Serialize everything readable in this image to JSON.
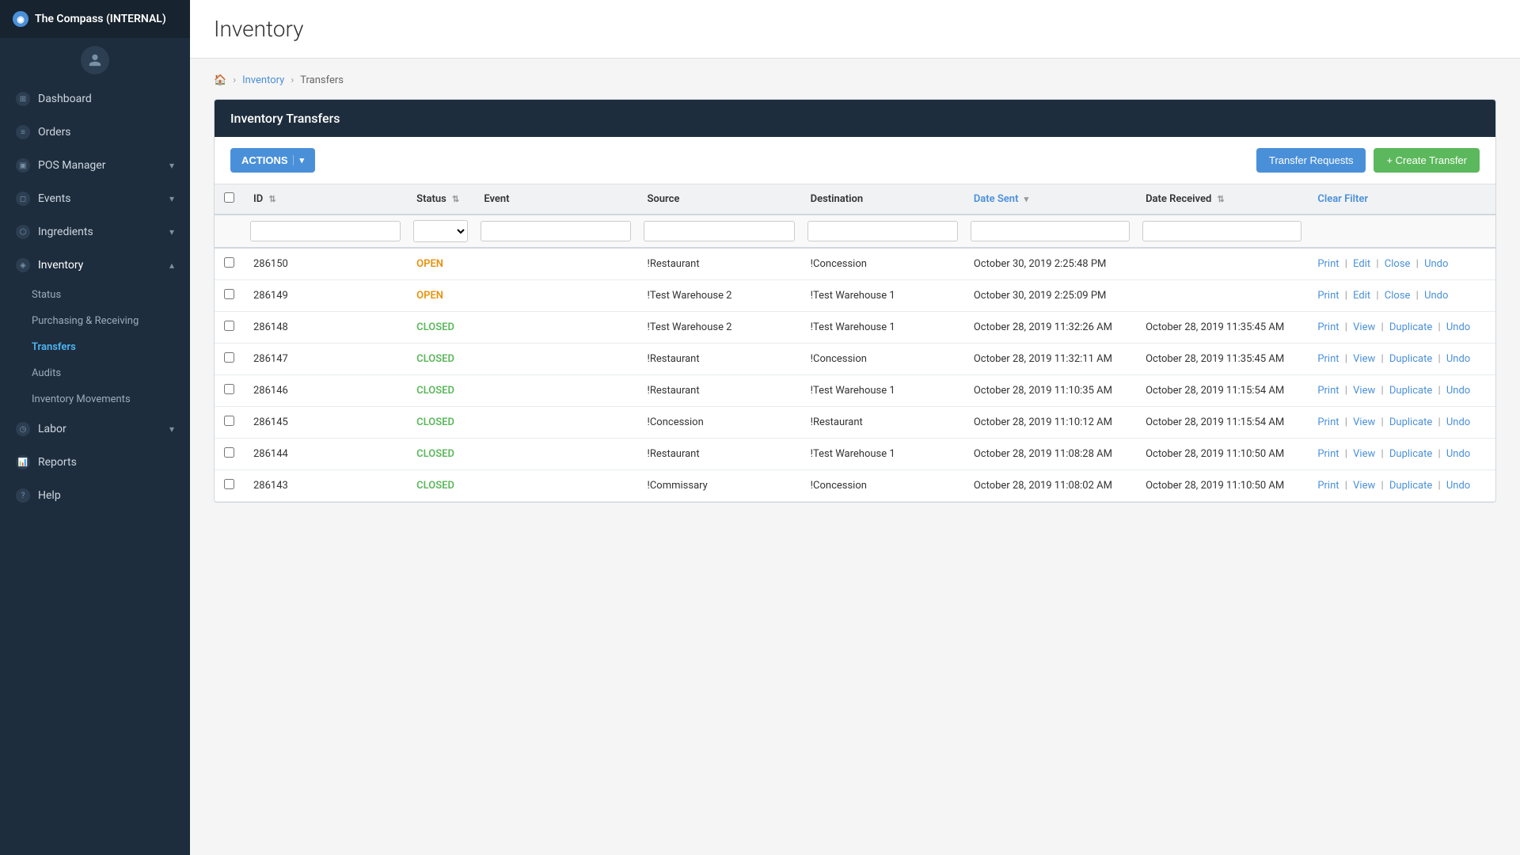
{
  "app": {
    "title": "The Compass (INTERNAL)"
  },
  "sidebar": {
    "user_icon": "👤",
    "items": [
      {
        "id": "dashboard",
        "label": "Dashboard",
        "icon": "⊞",
        "has_children": false
      },
      {
        "id": "orders",
        "label": "Orders",
        "icon": "📋",
        "has_children": false
      },
      {
        "id": "pos-manager",
        "label": "POS Manager",
        "icon": "🖥",
        "has_children": true
      },
      {
        "id": "events",
        "label": "Events",
        "icon": "📅",
        "has_children": true
      },
      {
        "id": "ingredients",
        "label": "Ingredients",
        "icon": "🧪",
        "has_children": true
      },
      {
        "id": "inventory",
        "label": "Inventory",
        "icon": "📦",
        "has_children": true,
        "active": true
      },
      {
        "id": "labor",
        "label": "Labor",
        "icon": "👷",
        "has_children": true
      },
      {
        "id": "reports",
        "label": "Reports",
        "icon": "📊",
        "has_children": false
      },
      {
        "id": "help",
        "label": "Help",
        "icon": "❓",
        "has_children": false
      }
    ],
    "inventory_sub": [
      {
        "id": "status",
        "label": "Status"
      },
      {
        "id": "purchasing-receiving",
        "label": "Purchasing & Receiving"
      },
      {
        "id": "transfers",
        "label": "Transfers",
        "active": true
      },
      {
        "id": "audits",
        "label": "Audits"
      },
      {
        "id": "inventory-movements",
        "label": "Inventory Movements"
      }
    ]
  },
  "page": {
    "title": "Inventory"
  },
  "breadcrumb": {
    "home_icon": "🏠",
    "items": [
      "Inventory",
      "Transfers"
    ]
  },
  "table": {
    "title": "Inventory Transfers",
    "actions_label": "ACTIONS",
    "transfer_requests_label": "Transfer Requests",
    "create_transfer_label": "+ Create Transfer",
    "clear_filter_label": "Clear Filter",
    "columns": [
      "ID",
      "Status",
      "Event",
      "Source",
      "Destination",
      "Date Sent",
      "Date Received",
      ""
    ],
    "rows": [
      {
        "id": "286150",
        "status": "OPEN",
        "status_class": "open",
        "event": "",
        "source": "!Restaurant",
        "destination": "!Concession",
        "date_sent": "October 30, 2019 2:25:48 PM",
        "date_received": "",
        "actions": [
          {
            "label": "Print"
          },
          {
            "label": "Edit"
          },
          {
            "label": "Close"
          },
          {
            "label": "Undo"
          }
        ],
        "action_str": "Print | Edit | Close | Undo"
      },
      {
        "id": "286149",
        "status": "OPEN",
        "status_class": "open",
        "event": "",
        "source": "!Test Warehouse 2",
        "destination": "!Test Warehouse 1",
        "date_sent": "October 30, 2019 2:25:09 PM",
        "date_received": "",
        "actions": [],
        "action_str": "Print | Edit | Close | Undo"
      },
      {
        "id": "286148",
        "status": "CLOSED",
        "status_class": "closed",
        "event": "",
        "source": "!Test Warehouse 2",
        "destination": "!Test Warehouse 1",
        "date_sent": "October 28, 2019 11:32:26 AM",
        "date_received": "October 28, 2019 11:35:45 AM",
        "action_str": "Print | View | Duplicate | Undo"
      },
      {
        "id": "286147",
        "status": "CLOSED",
        "status_class": "closed",
        "event": "",
        "source": "!Restaurant",
        "destination": "!Concession",
        "date_sent": "October 28, 2019 11:32:11 AM",
        "date_received": "October 28, 2019 11:35:45 AM",
        "action_str": "Print | View | Duplicate | Undo"
      },
      {
        "id": "286146",
        "status": "CLOSED",
        "status_class": "closed",
        "event": "",
        "source": "!Restaurant",
        "destination": "!Test Warehouse 1",
        "date_sent": "October 28, 2019 11:10:35 AM",
        "date_received": "October 28, 2019 11:15:54 AM",
        "action_str": "Print | View | Duplicate | Undo"
      },
      {
        "id": "286145",
        "status": "CLOSED",
        "status_class": "closed",
        "event": "",
        "source": "!Concession",
        "destination": "!Restaurant",
        "date_sent": "October 28, 2019 11:10:12 AM",
        "date_received": "October 28, 2019 11:15:54 AM",
        "action_str": "Print | View | Duplicate | Undo"
      },
      {
        "id": "286144",
        "status": "CLOSED",
        "status_class": "closed",
        "event": "",
        "source": "!Restaurant",
        "destination": "!Test Warehouse 1",
        "date_sent": "October 28, 2019 11:08:28 AM",
        "date_received": "October 28, 2019 11:10:50 AM",
        "action_str": "Print | View | Duplicate | Undo"
      },
      {
        "id": "286143",
        "status": "CLOSED",
        "status_class": "closed",
        "event": "",
        "source": "!Commissary",
        "destination": "!Concession",
        "date_sent": "October 28, 2019 11:08:02 AM",
        "date_received": "October 28, 2019 11:10:50 AM",
        "action_str": "Print | View | Duplicate | Undo"
      }
    ]
  }
}
